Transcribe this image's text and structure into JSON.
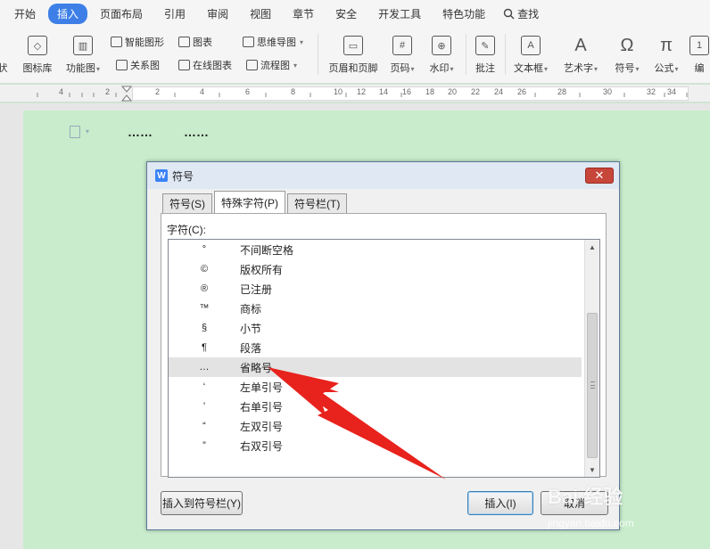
{
  "menubar": {
    "items": [
      "开始",
      "插入",
      "页面布局",
      "引用",
      "审阅",
      "视图",
      "章节",
      "安全",
      "开发工具",
      "特色功能"
    ],
    "active_index": 1,
    "search_label": "查找"
  },
  "ribbon": {
    "partial_left_label": "状",
    "big_buttons": [
      {
        "label": "图标库",
        "icon": "icon-library-icon"
      },
      {
        "label": "功能图",
        "icon": "function-chart-icon",
        "has_dropdown": true
      },
      {
        "label": "页眉和页脚",
        "icon": "header-footer-icon"
      },
      {
        "label": "页码",
        "icon": "page-number-icon",
        "has_dropdown": true
      },
      {
        "label": "水印",
        "icon": "watermark-icon",
        "has_dropdown": true
      },
      {
        "label": "批注",
        "icon": "comment-icon"
      },
      {
        "label": "文本框",
        "icon": "textbox-icon",
        "has_dropdown": true
      },
      {
        "label": "艺术字",
        "icon": "wordart-icon",
        "has_dropdown": true
      },
      {
        "label": "符号",
        "icon": "symbol-icon",
        "has_dropdown": true
      },
      {
        "label": "公式",
        "icon": "formula-icon",
        "has_dropdown": true
      },
      {
        "label": "编",
        "icon": "numbering-icon"
      }
    ],
    "small_buttons": [
      {
        "label": "智能图形",
        "icon": "smart-graphic-icon"
      },
      {
        "label": "图表",
        "icon": "chart-icon"
      },
      {
        "label": "思维导图",
        "icon": "mindmap-icon",
        "has_dropdown": true
      },
      {
        "label": "关系图",
        "icon": "relation-icon"
      },
      {
        "label": "在线图表",
        "icon": "online-chart-icon"
      },
      {
        "label": "流程图",
        "icon": "flowchart-icon",
        "has_dropdown": true
      }
    ]
  },
  "ruler": {
    "numbers": [
      "4",
      "2",
      "2",
      "4",
      "6",
      "8",
      "10",
      "12",
      "14",
      "16",
      "18",
      "20",
      "22",
      "24",
      "26",
      "28",
      "30",
      "32",
      "34"
    ]
  },
  "document": {
    "text_left": "……",
    "text_right": "……"
  },
  "dialog": {
    "logo": "W",
    "title": "符号",
    "close_label": "✕",
    "tabs": [
      "符号(S)",
      "特殊字符(P)",
      "符号栏(T)"
    ],
    "active_tab_index": 1,
    "list_label": "字符(C):",
    "rows": [
      {
        "symbol": "°",
        "name": "不间断空格"
      },
      {
        "symbol": "©",
        "name": "版权所有"
      },
      {
        "symbol": "®",
        "name": "已注册"
      },
      {
        "symbol": "™",
        "name": "商标"
      },
      {
        "symbol": "§",
        "name": "小节"
      },
      {
        "symbol": "¶",
        "name": "段落"
      },
      {
        "symbol": "…",
        "name": "省略号"
      },
      {
        "symbol": "‘",
        "name": "左单引号"
      },
      {
        "symbol": "’",
        "name": "右单引号"
      },
      {
        "symbol": "“",
        "name": "左双引号"
      },
      {
        "symbol": "”",
        "name": "右双引号"
      }
    ],
    "selected_row_index": 6,
    "buttons": {
      "insert_to_bar": "插入到符号栏(Y)",
      "insert": "插入(I)",
      "close": "取消"
    }
  },
  "watermark": {
    "brand": "Bai 经验",
    "url": "jingyan.baidu.com"
  },
  "colors": {
    "accent": "#3d7fe6",
    "page_bg": "#c8eccc",
    "annotation_red": "#e8221c"
  }
}
